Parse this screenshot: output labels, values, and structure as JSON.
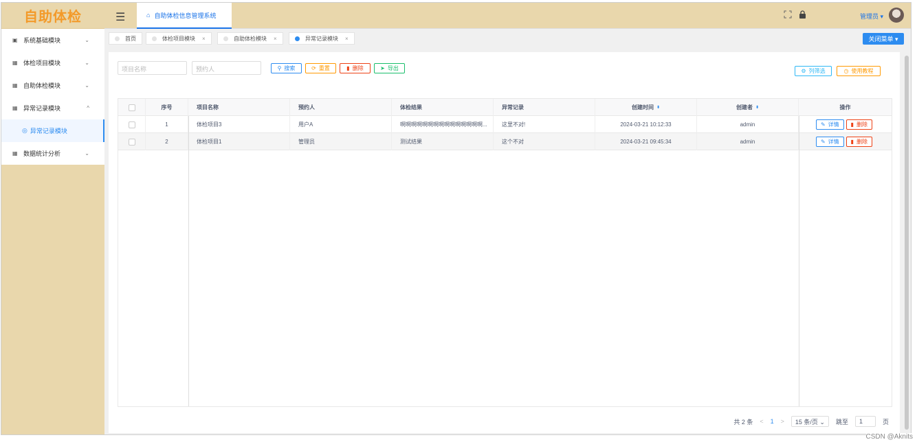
{
  "app": {
    "logo": "自助体检",
    "title": "自助体检信息管理系统"
  },
  "header": {
    "user": "管理员",
    "user_caret": "▾",
    "fullscreen_icon": "fullscreen-icon",
    "lock_icon": "lock-icon"
  },
  "sidebar": {
    "items": [
      {
        "label": "系统基础模块",
        "icon": "▣",
        "chevron": "⌄"
      },
      {
        "label": "体检项目模块",
        "icon": "▦",
        "chevron": "⌄"
      },
      {
        "label": "自助体检模块",
        "icon": "▦",
        "chevron": "⌄"
      },
      {
        "label": "异常记录模块",
        "icon": "▦",
        "chevron": "^"
      },
      {
        "label": "数据统计分析",
        "icon": "▦",
        "chevron": "⌄"
      }
    ],
    "sub": {
      "label": "异常记录模块",
      "icon": "◎"
    }
  },
  "tabs": [
    {
      "label": "首页",
      "close": ""
    },
    {
      "label": "体检项目模块",
      "close": "×"
    },
    {
      "label": "自助体检模块",
      "close": "×"
    },
    {
      "label": "异常记录模块",
      "close": "×"
    }
  ],
  "close_menu": "关闭菜单 ▾",
  "search": {
    "name_placeholder": "项目名称",
    "person_placeholder": "预约人",
    "btn_search": "搜索",
    "btn_reset": "重置",
    "btn_delete": "删除",
    "btn_export": "导出",
    "btn_filter": "列筛选",
    "btn_tutorial": "使用教程"
  },
  "table": {
    "headers": [
      "序号",
      "项目名称",
      "预约人",
      "体检结果",
      "异常记录",
      "创建时间",
      "创建者",
      "操作"
    ],
    "sort_glyph": "⬍",
    "rows": [
      {
        "no": "1",
        "name": "体检项目3",
        "person": "用户A",
        "result": "啊啊啊啊啊啊啊啊啊啊啊啊啊啊啊...",
        "abnormal": "这里不对!",
        "time": "2024-03-21 10:12:33",
        "creator": "admin"
      },
      {
        "no": "2",
        "name": "体检项目1",
        "person": "管理员",
        "result": "测试结果",
        "abnormal": "这个不对",
        "time": "2024-03-21 09:45:34",
        "creator": "admin"
      }
    ],
    "btn_detail": "详情",
    "btn_del": "删除"
  },
  "pager": {
    "total": "共 2 条",
    "prev": "<",
    "page": "1",
    "next": ">",
    "size": "15 条/页 ⌄",
    "goto": "跳至",
    "goto_value": "1",
    "page_unit": "页"
  },
  "watermark": "CSDN @Aknits",
  "colors": {
    "primary": "#2d8cf0",
    "sidebar_bg": "#e9d7ac",
    "logo": "#f39a2a",
    "danger": "#ed4014",
    "warning": "#ff9900",
    "success": "#19be6b"
  }
}
